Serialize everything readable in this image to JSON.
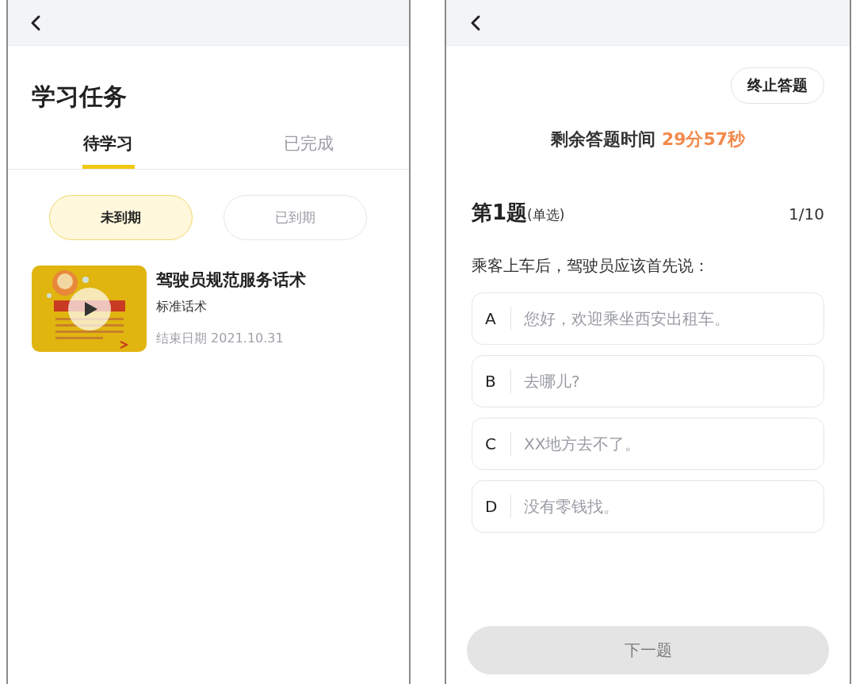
{
  "left_screen": {
    "title": "学习任务",
    "tabs": [
      {
        "label": "待学习",
        "selected": true
      },
      {
        "label": "已完成",
        "selected": false
      }
    ],
    "filters": [
      {
        "label": "未到期",
        "selected": true
      },
      {
        "label": "已到期",
        "selected": false
      }
    ],
    "tasks": [
      {
        "title": "驾驶员规范服务话术",
        "subtitle": "标准话术",
        "end_date": "结束日期 2021.10.31"
      }
    ]
  },
  "right_screen": {
    "stop_button": "终止答题",
    "timer": {
      "label": "剩余答题时间",
      "value": "29分57秒"
    },
    "question": {
      "number": "第1题",
      "type": "(单选)",
      "progress": "1/10",
      "text": "乘客上车后，驾驶员应该首先说：",
      "options": [
        {
          "letter": "A",
          "text": "您好，欢迎乘坐西安出租车。",
          "selected": false
        },
        {
          "letter": "B",
          "text": "去哪儿?",
          "selected": false
        },
        {
          "letter": "C",
          "text": "XX地方去不了。",
          "selected": false
        },
        {
          "letter": "D",
          "text": "没有零钱找。",
          "selected": false
        }
      ]
    },
    "next_button": {
      "label": "下一题",
      "disabled": true
    }
  }
}
